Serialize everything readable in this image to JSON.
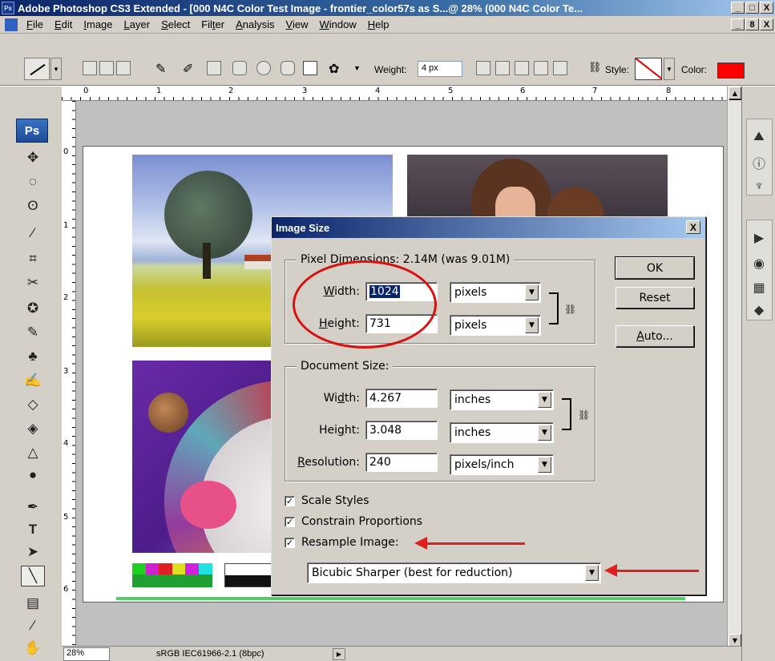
{
  "window": {
    "title": "Adobe Photoshop CS3 Extended - [000 N4C Color Test Image - frontier_color57s as S...@ 28% (000 N4C Color Te...",
    "app_icon": "Ps",
    "controls": [
      "_",
      "□",
      "X"
    ]
  },
  "menu": {
    "items": [
      {
        "label": "File",
        "key": "F",
        "rest": "ile"
      },
      {
        "label": "Edit",
        "key": "E",
        "rest": "dit"
      },
      {
        "label": "Image",
        "key": "I",
        "rest": "mage"
      },
      {
        "label": "Layer",
        "key": "L",
        "rest": "ayer"
      },
      {
        "label": "Select",
        "key": "S",
        "rest": "elect"
      },
      {
        "label": "Filter",
        "pre": "Fil",
        "key": "t",
        "rest": "er"
      },
      {
        "label": "Analysis",
        "key": "A",
        "rest": "nalysis"
      },
      {
        "label": "View",
        "key": "V",
        "rest": "iew"
      },
      {
        "label": "Window",
        "key": "W",
        "rest": "indow"
      },
      {
        "label": "Help",
        "key": "H",
        "rest": "elp"
      }
    ],
    "doc_controls": [
      "_",
      "8",
      "X"
    ]
  },
  "options_bar": {
    "weight_label": "Weight:",
    "weight_value": "4 px",
    "style_label": "Style:",
    "color_label": "Color:",
    "color_value": "#ff0000"
  },
  "rulers": {
    "top_marks": [
      "0",
      "1",
      "2",
      "3",
      "4",
      "5",
      "6",
      "7",
      "8"
    ],
    "left_marks": [
      "0",
      "1",
      "2",
      "3",
      "4",
      "5",
      "6"
    ]
  },
  "toolbox": {
    "logo": "Ps"
  },
  "status_bar": {
    "zoom": "28%",
    "info": "sRGB IEC61966-2.1 (8bpc)"
  },
  "dialog": {
    "title": "Image Size",
    "close": "X",
    "pixel_dimensions": {
      "legend": "Pixel Dimensions:",
      "size": "2.14M (was 9.01M)",
      "width_label": "Width:",
      "width_value": "1024",
      "width_unit": "pixels",
      "height_label": "Height:",
      "height_value": "731",
      "height_unit": "pixels"
    },
    "document_size": {
      "legend": "Document Size:",
      "width_label": "Width:",
      "width_value": "4.267",
      "width_unit": "inches",
      "height_label": "Height:",
      "height_value": "3.048",
      "height_unit": "inches",
      "resolution_label": "Resolution:",
      "resolution_value": "240",
      "resolution_unit": "pixels/inch"
    },
    "buttons": {
      "ok": "OK",
      "reset": "Reset",
      "auto": "Auto..."
    },
    "checkboxes": {
      "scale_styles": {
        "label": "Scale Styles",
        "checked": true
      },
      "constrain": {
        "label": "Constrain Proportions",
        "checked": true
      },
      "resample": {
        "label": "Resample Image:",
        "checked": true
      }
    },
    "resample_method": "Bicubic Sharper (best for reduction)"
  },
  "annotations": {
    "highlight_color": "#e02020"
  }
}
